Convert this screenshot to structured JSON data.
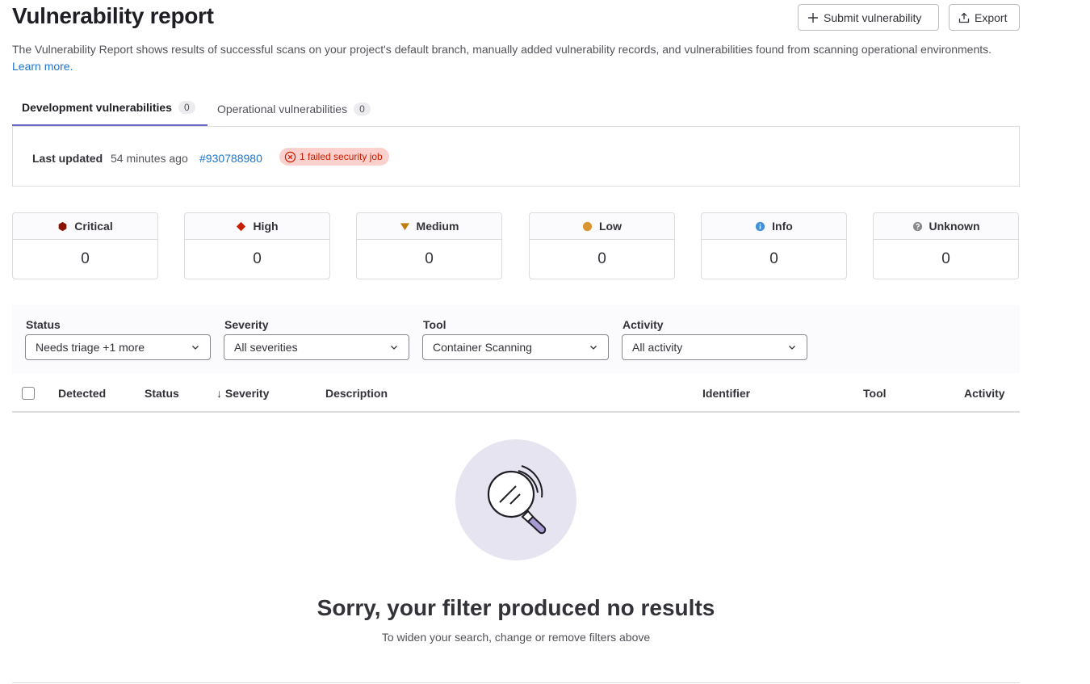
{
  "page": {
    "title": "Vulnerability report",
    "description": "The Vulnerability Report shows results of successful scans on your project's default branch, manually added vulnerability records, and vulnerabilities found from scanning operational environments.",
    "learn_more": "Learn more."
  },
  "header_buttons": {
    "submit": "Submit vulnerability",
    "export": "Export"
  },
  "tabs": [
    {
      "label": "Development vulnerabilities",
      "count": "0",
      "active": true
    },
    {
      "label": "Operational vulnerabilities",
      "count": "0",
      "active": false
    }
  ],
  "last_updated": {
    "label": "Last updated",
    "ago": "54 minutes ago",
    "pipeline": "#930788980",
    "failed_badge": "1 failed security job"
  },
  "severities": [
    {
      "label": "Critical",
      "count": "0",
      "icon": "severity-critical-icon",
      "color": "#8d1300"
    },
    {
      "label": "High",
      "count": "0",
      "icon": "severity-high-icon",
      "color": "#c91c00"
    },
    {
      "label": "Medium",
      "count": "0",
      "icon": "severity-medium-icon",
      "color": "#c17d10"
    },
    {
      "label": "Low",
      "count": "0",
      "icon": "severity-low-icon",
      "color": "#d99530"
    },
    {
      "label": "Info",
      "count": "0",
      "icon": "severity-info-icon",
      "color": "#428fdc"
    },
    {
      "label": "Unknown",
      "count": "0",
      "icon": "severity-unknown-icon",
      "color": "#89888d"
    }
  ],
  "filters": [
    {
      "label": "Status",
      "value": "Needs triage +1 more"
    },
    {
      "label": "Severity",
      "value": "All severities"
    },
    {
      "label": "Tool",
      "value": "Container Scanning"
    },
    {
      "label": "Activity",
      "value": "All activity"
    }
  ],
  "table": {
    "columns": [
      "Detected",
      "Status",
      "Severity",
      "Description",
      "Identifier",
      "Tool",
      "Activity"
    ],
    "sort_indicator": "↓"
  },
  "empty_state": {
    "title": "Sorry, your filter produced no results",
    "subtitle": "To widen your search, change or remove filters above"
  },
  "colors": {
    "accent": "#6666c4",
    "link": "#1f75cb",
    "danger_bg": "#fcd1cd",
    "danger_text": "#c91c00"
  }
}
